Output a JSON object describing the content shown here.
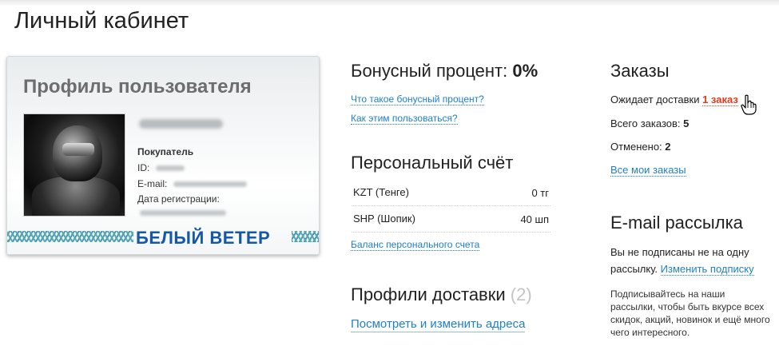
{
  "page": {
    "title": "Личный кабинет"
  },
  "profile": {
    "card_title": "Профиль пользователя",
    "role": "Покупатель",
    "id_label": "ID:",
    "email_label": "E-mail:",
    "reg_label": "Дата регистрации:",
    "brand": "БЕЛЫЙ ВЕТЕР"
  },
  "bonus": {
    "title": "Бонусный процент:",
    "value": "0%",
    "link_what": "Что такое бонусный процент?",
    "link_how": "Как этим пользоваться?"
  },
  "account": {
    "title": "Персональный счёт",
    "rows": [
      {
        "currency": "KZT (Тенге)",
        "amount": "0 тг"
      },
      {
        "currency": "SHP (Шопик)",
        "amount": "40 шп"
      }
    ],
    "balance_link": "Баланс персонального счета"
  },
  "delivery": {
    "title": "Профили доставки",
    "count": "(2)",
    "link": "Посмотреть и изменить адреса"
  },
  "orders": {
    "title": "Заказы",
    "awaiting_label": "Ожидает доставки",
    "awaiting_value": "1 заказ",
    "total_label": "Всего заказов:",
    "total_value": "5",
    "cancelled_label": "Отменено:",
    "cancelled_value": "2",
    "all_link": "Все мои заказы"
  },
  "newsletter": {
    "title": "E-mail рассылка",
    "status_text": "Вы не подписаны не на одну рассылку.",
    "change_link": "Изменить подписку",
    "promo_text": "Подписывайтесь на наши рассылки, чтобы быть вкурсе всех скидок, акций, новинок и ещё много чего интересного."
  }
}
